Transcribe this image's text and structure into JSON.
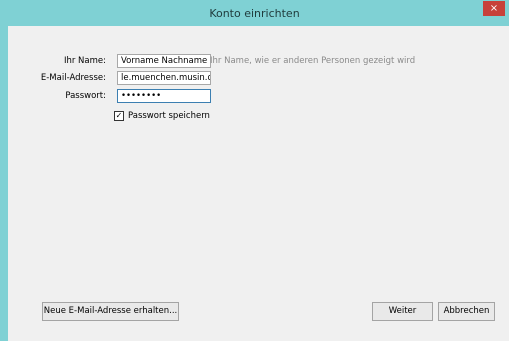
{
  "window": {
    "title": "Konto einrichten",
    "close_glyph": "×"
  },
  "form": {
    "name_label": "Ihr Name:",
    "name_value": "Vorname Nachname",
    "name_hint": "Ihr Name, wie er anderen Personen gezeigt wird",
    "email_label": "E-Mail-Adresse:",
    "email_value": "le.muenchen.musin.de",
    "password_label": "Passwort:",
    "password_value": "••••••••",
    "remember_password_label": "Passwort speichern",
    "remember_password_checked": true
  },
  "buttons": {
    "new_address": "Neue E-Mail-Adresse erhalten...",
    "next": "Weiter",
    "cancel": "Abbrechen"
  },
  "colors": {
    "titlebar": "#7fd1d4",
    "close": "#c7413a",
    "client": "#f0f0f0"
  }
}
